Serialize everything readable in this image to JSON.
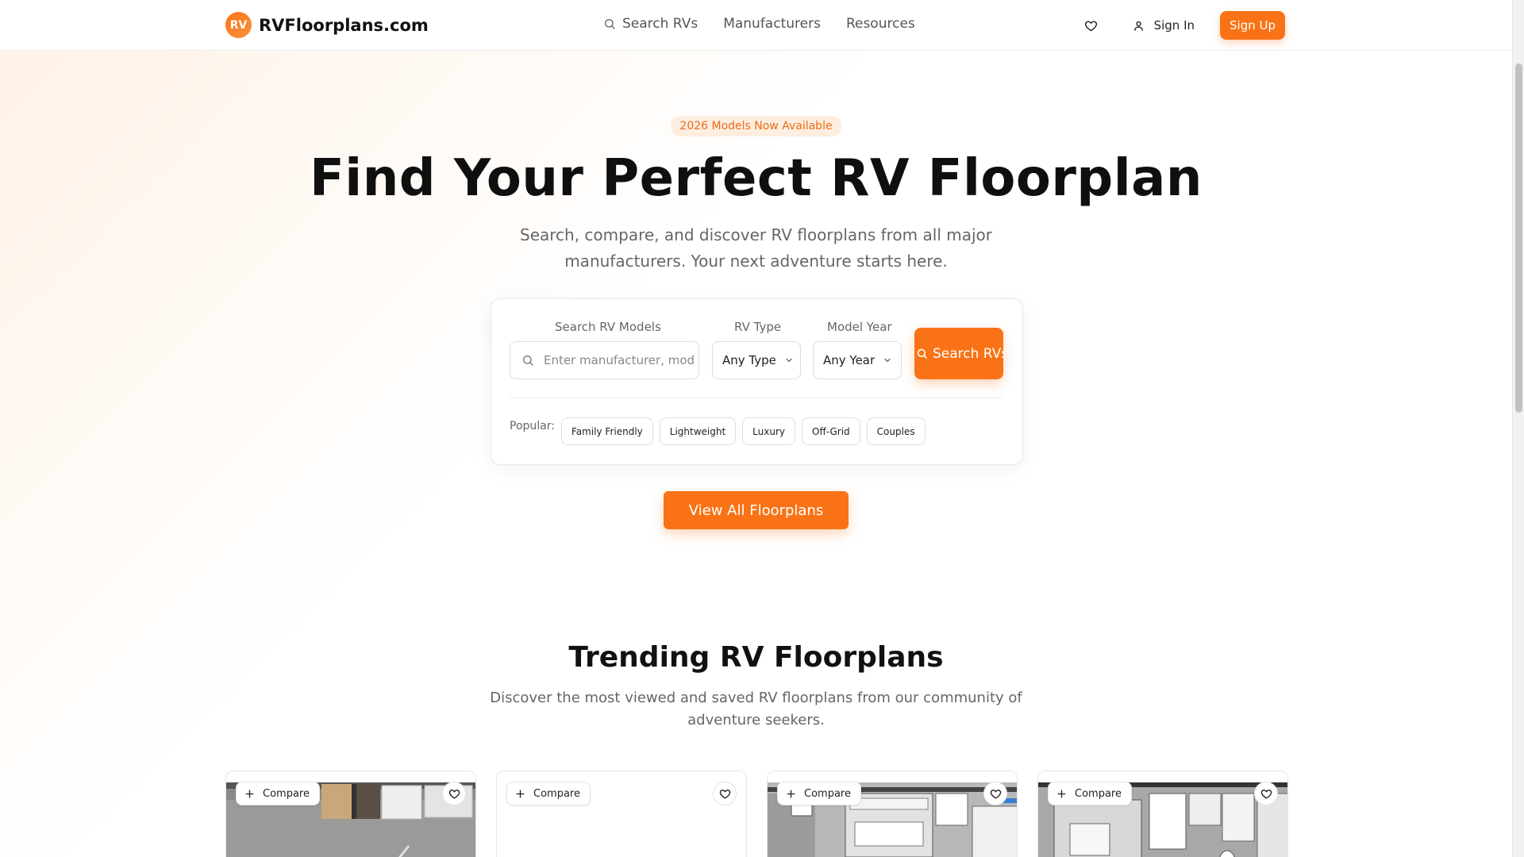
{
  "brand": {
    "badge": "RV",
    "name": "RVFloorplans.com"
  },
  "nav": [
    {
      "label": "Search RVs",
      "icon": "search-icon"
    },
    {
      "label": "Manufacturers"
    },
    {
      "label": "Resources"
    }
  ],
  "header_actions": {
    "favorites_icon": "heart-icon",
    "sign_in": "Sign In",
    "sign_up": "Sign Up"
  },
  "hero": {
    "badge": "2026 Models Now Available",
    "title": "Find Your Perfect RV Floorplan",
    "subtitle_line1": "Search, compare, and discover RV floorplans from all major",
    "subtitle_line2": "manufacturers. Your next adventure starts here."
  },
  "search": {
    "models_label": "Search RV Models",
    "models_placeholder": "Enter manufacturer, model...",
    "type_label": "RV Type",
    "type_value": "Any Type",
    "year_label": "Model Year",
    "year_value": "Any Year",
    "button": "Search RVs",
    "popular_label": "Popular:",
    "popular_tags": [
      "Family Friendly",
      "Lightweight",
      "Luxury",
      "Off-Grid",
      "Couples"
    ]
  },
  "view_all": "View All Floorplans",
  "trending": {
    "title": "Trending RV Floorplans",
    "subtitle_line1": "Discover the most viewed and saved RV floorplans from our community of",
    "subtitle_line2": "adventure seekers.",
    "cards": [
      {
        "compare": "Compare"
      },
      {
        "compare": "Compare"
      },
      {
        "compare": "Compare"
      },
      {
        "compare": "Compare"
      }
    ]
  },
  "colors": {
    "accent": "#f97316",
    "badge_bg": "#fdeee0",
    "badge_text": "#ea6d14"
  }
}
